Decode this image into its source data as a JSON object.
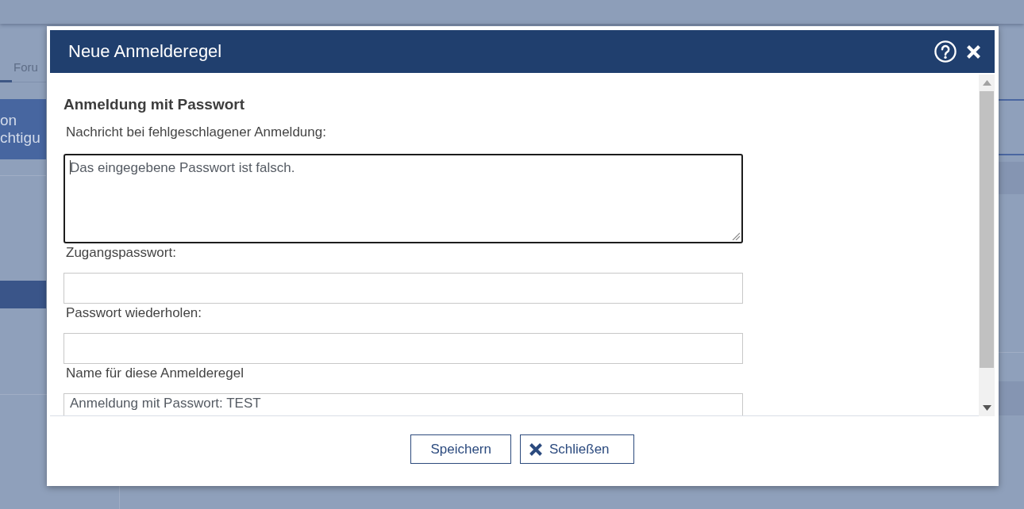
{
  "background": {
    "tab": "Foru",
    "tile_lines": [
      "on",
      "chtigu"
    ]
  },
  "dialog": {
    "title": "Neue Anmelderegel",
    "heading": "Anmeldung mit Passwort",
    "fields": [
      {
        "kind": "textarea",
        "label": "Nachricht bei fehlgeschlagener Anmeldung:",
        "value": "Das eingegebene Passwort ist falsch.",
        "focused": true
      },
      {
        "kind": "input",
        "label": "Zugangspasswort:",
        "focused": false
      },
      {
        "kind": "input",
        "label": "Passwort wiederholen:",
        "focused": false
      },
      {
        "kind": "input",
        "label": "Name für diese Anmelderegel",
        "value": "Anmeldung mit Passwort: TEST",
        "focused": false
      }
    ],
    "buttons": [
      {
        "kind": "save",
        "label": "Speichern"
      },
      {
        "kind": "close",
        "label": "Schließen"
      }
    ]
  }
}
